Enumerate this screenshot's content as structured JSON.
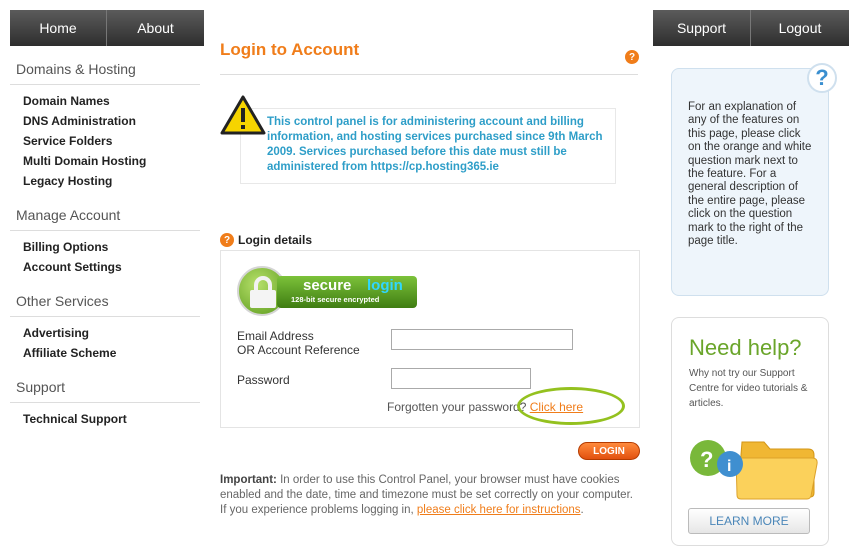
{
  "nav": {
    "home": "Home",
    "about": "About",
    "support": "Support",
    "logout": "Logout"
  },
  "sidebar": {
    "sections": [
      {
        "title": "Domains & Hosting",
        "items": [
          "Domain Names",
          "DNS Administration",
          "Service Folders",
          "Multi Domain Hosting",
          "Legacy Hosting"
        ]
      },
      {
        "title": "Manage Account",
        "items": [
          "Billing Options",
          "Account Settings"
        ]
      },
      {
        "title": "Other Services",
        "items": [
          "Advertising",
          "Affiliate Scheme"
        ]
      },
      {
        "title": "Support",
        "items": [
          "Technical Support"
        ]
      }
    ]
  },
  "main": {
    "title": "Login to Account",
    "help_mark": "?",
    "notice": "This control panel is for administering account and billing information, and hosting services purchased since 9th March 2009. Services purchased before this date must still be administered from https://cp.hosting365.ie",
    "login_details": "Login details",
    "secure_badge": {
      "word1": "secure",
      "word2": "login",
      "sub": "128-bit secure encrypted"
    },
    "email_label_1": "Email Address",
    "email_label_2": "OR Account Reference",
    "email_value": "",
    "password_label": "Password",
    "password_value": "",
    "forgot_text": "Forgotten your password?",
    "forgot_link": "Click here",
    "login_button": "LOGIN",
    "important_label": "Important:",
    "important_text": "In order to use this Control Panel, your browser must have cookies enabled and the date, time and timezone must be set correctly on your computer. If you experience problems logging in,",
    "important_link": "please click here for instructions",
    "important_end": "."
  },
  "help_panel": {
    "mark": "?",
    "text": "For an explanation of any of the features on this page, please click on the orange and white question mark next to the feature. For a general description of the entire page, please click on the question mark to the right of the page title."
  },
  "need_help": {
    "title": "Need help?",
    "text": "Why not try our Support Centre for video tutorials & articles.",
    "button": "LEARN MORE"
  },
  "colors": {
    "accent_orange": "#f07d1a",
    "notice_blue": "#2e9ec8",
    "help_green": "#6aa52a",
    "nav_dark": "#3a3a3a"
  }
}
